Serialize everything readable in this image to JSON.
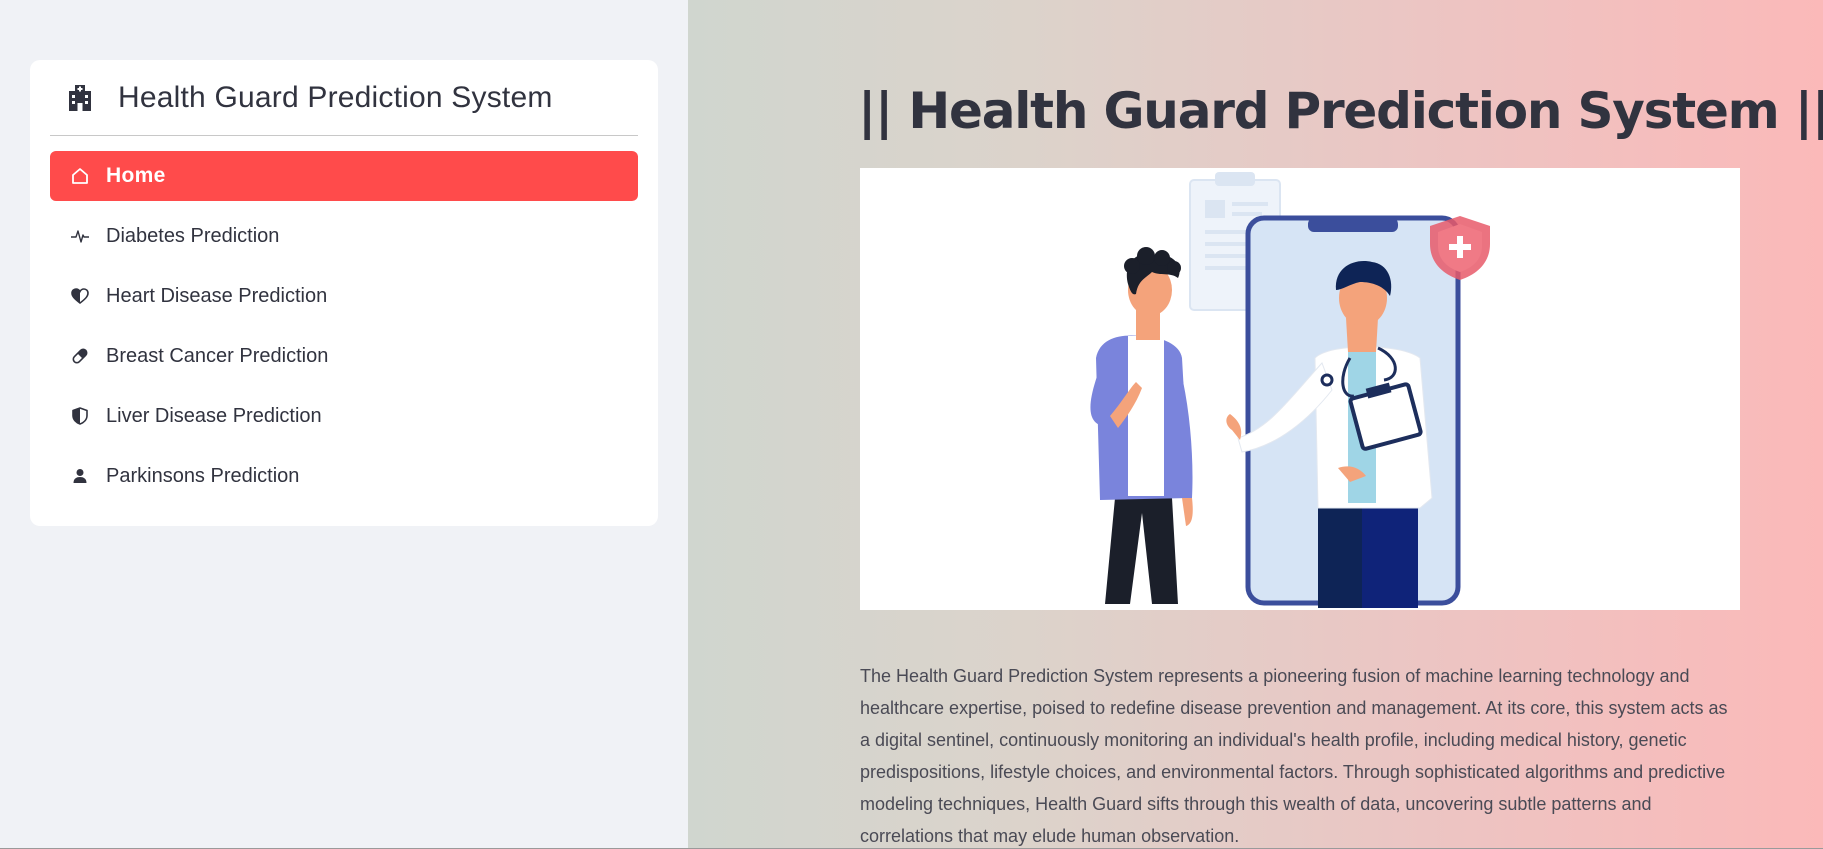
{
  "sidebar": {
    "logo_icon": "hospital-icon",
    "title": "Health Guard Prediction System",
    "accent_color": "#ff4b4b",
    "items": [
      {
        "label": "Home",
        "icon": "house-icon",
        "active": true
      },
      {
        "label": "Diabetes Prediction",
        "icon": "activity-icon",
        "active": false
      },
      {
        "label": "Heart Disease Prediction",
        "icon": "heart-half-icon",
        "active": false
      },
      {
        "label": "Breast Cancer Prediction",
        "icon": "capsule-icon",
        "active": false
      },
      {
        "label": "Liver Disease Prediction",
        "icon": "shield-half-icon",
        "active": false
      },
      {
        "label": "Parkinsons Prediction",
        "icon": "person-icon",
        "active": false
      }
    ]
  },
  "main": {
    "title": "|| Health Guard Prediction System ||",
    "hero_image": "doctor-consultation-illustration",
    "description": "The Health Guard Prediction System represents a pioneering fusion of machine learning technology and healthcare expertise, poised to redefine disease prevention and management. At its core, this system acts as a digital sentinel, continuously monitoring an individual's health profile, including medical history, genetic predispositions, lifestyle choices, and environmental factors. Through sophisticated algorithms and predictive modeling techniques, Health Guard sifts through this wealth of data, uncovering subtle patterns and correlations that may elude human observation."
  }
}
